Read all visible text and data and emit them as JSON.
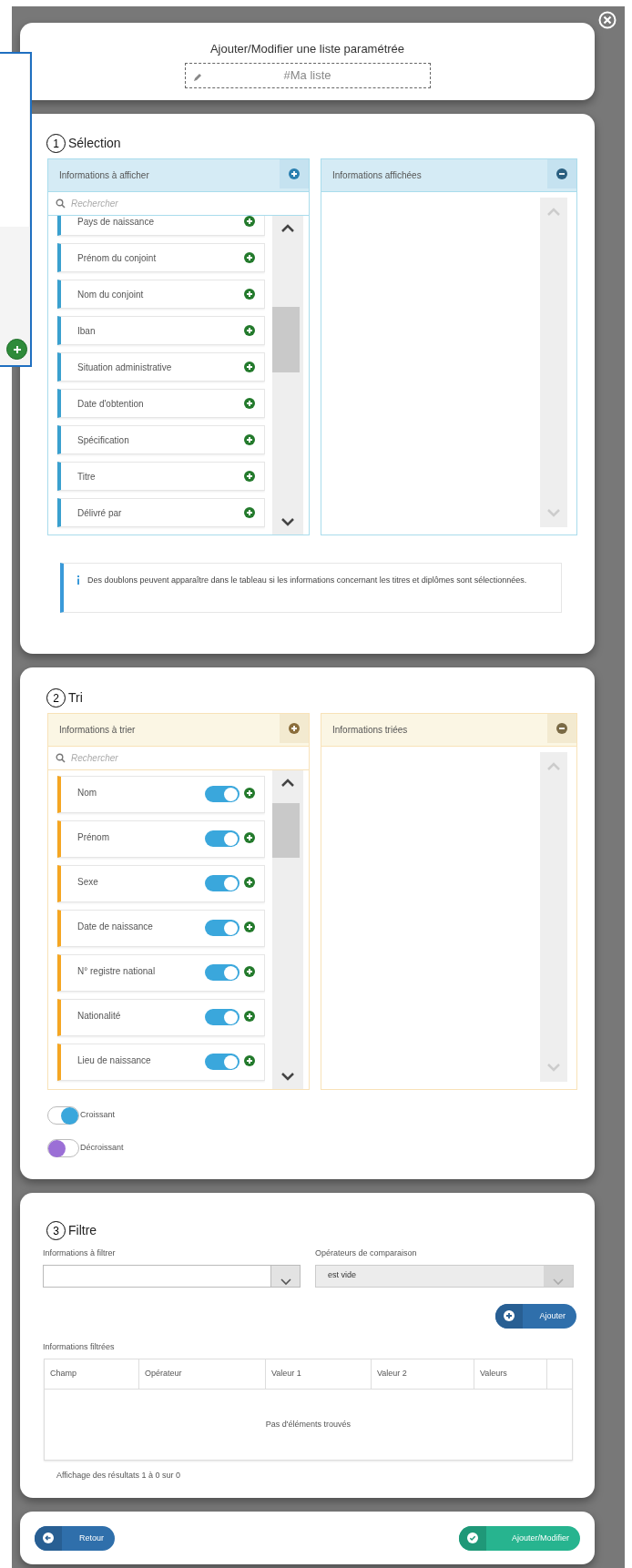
{
  "dialog": {
    "title": "Ajouter/Modifier une liste paramétrée",
    "name_field": {
      "value": "#Ma liste"
    }
  },
  "selection": {
    "number": "1",
    "title": "Sélection",
    "available": {
      "title": "Informations à afficher",
      "search_placeholder": "Rechercher",
      "items": [
        {
          "label": "Pays de naissance"
        },
        {
          "label": "Prénom du conjoint"
        },
        {
          "label": "Nom du conjoint"
        },
        {
          "label": "Iban"
        },
        {
          "label": "Situation administrative"
        },
        {
          "label": "Date d'obtention"
        },
        {
          "label": "Spécification"
        },
        {
          "label": "Titre"
        },
        {
          "label": "Délivré par"
        }
      ]
    },
    "chosen": {
      "title": "Informations affichées"
    },
    "note": "Des doublons peuvent apparaître dans le tableau si les informations concernant les titres et diplômes sont sélectionnées."
  },
  "sort": {
    "number": "2",
    "title": "Tri",
    "available": {
      "title": "Informations à trier",
      "search_placeholder": "Rechercher",
      "items": [
        {
          "label": "Nom",
          "on": true
        },
        {
          "label": "Prénom",
          "on": true
        },
        {
          "label": "Sexe",
          "on": true
        },
        {
          "label": "Date de naissance",
          "on": true
        },
        {
          "label": "N° registre national",
          "on": true
        },
        {
          "label": "Nationalité",
          "on": true
        },
        {
          "label": "Lieu de naissance",
          "on": true
        }
      ]
    },
    "chosen": {
      "title": "Informations triées"
    },
    "legend": [
      {
        "label": "Croissant",
        "on": true
      },
      {
        "label": "Décroissant",
        "on": false
      }
    ]
  },
  "filter": {
    "number": "3",
    "title": "Filtre",
    "field_label": "Informations à filtrer",
    "operator_label": "Opérateurs de comparaison",
    "operator_value": "est vide",
    "operator_disabled": true,
    "add_button": "Ajouter",
    "table_label": "Informations filtrées",
    "columns": [
      "Champ",
      "Opérateur",
      "Valeur 1",
      "Valeur 2",
      "Valeurs"
    ],
    "empty_message": "Pas d'éléments trouvés",
    "summary": "Affichage des résultats 1 à 0 sur 0"
  },
  "footer_buttons": [
    {
      "label": "Retour",
      "kind": "back"
    },
    {
      "label": "Ajouter/Modifier",
      "kind": "confirm"
    }
  ]
}
